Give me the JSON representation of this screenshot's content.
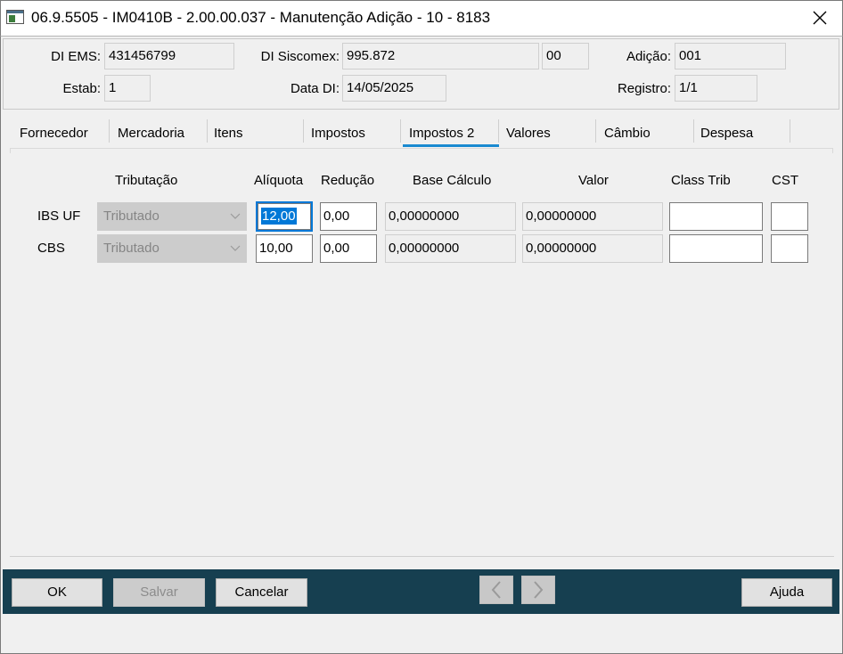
{
  "window": {
    "title": "06.9.5505 - IM0410B - 2.00.00.037 - Manutenção Adição - 10 - 8183"
  },
  "header": {
    "di_ems_label": "DI EMS:",
    "di_ems_value": "431456799",
    "di_siscomex_label": "DI Siscomex:",
    "di_siscomex_value": "995.872",
    "di_siscomex_suffix": "00",
    "adicao_label": "Adição:",
    "adicao_value": "001",
    "estab_label": "Estab:",
    "estab_value": "1",
    "data_di_label": "Data DI:",
    "data_di_value": "14/05/2025",
    "registro_label": "Registro:",
    "registro_value": "1/1"
  },
  "tabs": [
    {
      "label": "Fornecedor"
    },
    {
      "label": "Mercadoria"
    },
    {
      "label": "Itens"
    },
    {
      "label": "Impostos"
    },
    {
      "label": "Impostos 2"
    },
    {
      "label": "Valores"
    },
    {
      "label": "Câmbio"
    },
    {
      "label": "Despesa"
    }
  ],
  "active_tab": "Impostos 2",
  "grid": {
    "headers": {
      "tributacao": "Tributação",
      "aliquota": "Alíquota",
      "reducao": "Redução",
      "base_calculo": "Base Cálculo",
      "valor": "Valor",
      "class_trib": "Class Trib",
      "cst": "CST"
    },
    "rows": [
      {
        "label": "IBS UF",
        "tributacao": "Tributado",
        "aliquota": "12,00",
        "reducao": "0,00",
        "base_calculo": "0,00000000",
        "valor": "0,00000000",
        "class_trib": "",
        "cst": ""
      },
      {
        "label": "CBS",
        "tributacao": "Tributado",
        "aliquota": "10,00",
        "reducao": "0,00",
        "base_calculo": "0,00000000",
        "valor": "0,00000000",
        "class_trib": "",
        "cst": ""
      }
    ]
  },
  "buttons": {
    "ok": "OK",
    "salvar": "Salvar",
    "cancelar": "Cancelar",
    "ajuda": "Ajuda"
  },
  "icons": {
    "app": "window-app-icon",
    "close": "close-icon",
    "prev": "chevron-left-icon",
    "next": "chevron-right-icon",
    "dropdown": "chevron-down-icon"
  },
  "colors": {
    "button_bar": "#163f50",
    "tab_accent": "#1a8ad0",
    "selection": "#0078d7"
  }
}
